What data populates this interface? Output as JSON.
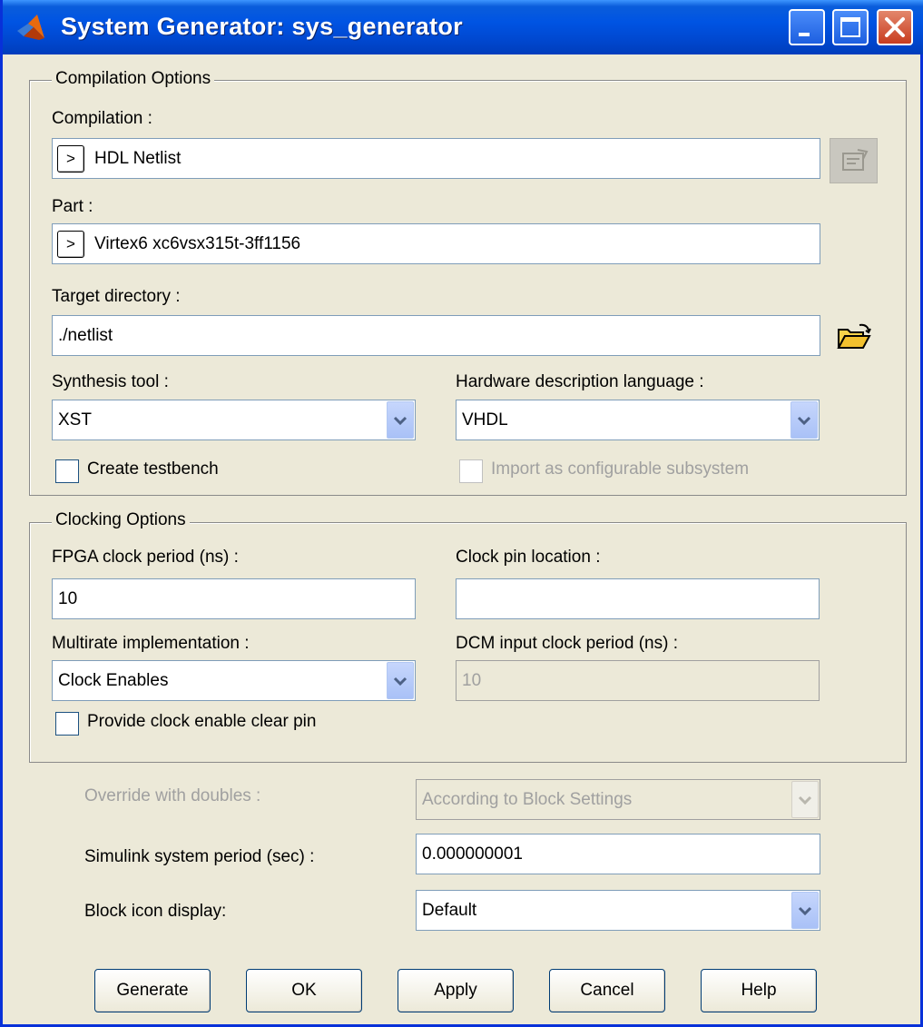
{
  "window": {
    "title": "System Generator: sys_generator",
    "accent_color": "#0054e3",
    "close_color": "#c83c1f"
  },
  "compilation_options": {
    "group_title": "Compilation Options",
    "compilation_label": "Compilation :",
    "compilation_value": "HDL Netlist",
    "expander_glyph": ">",
    "settings_icon": "compilation-settings-icon",
    "part_label": "Part :",
    "part_value": "Virtex6  xc6vsx315t-3ff1156",
    "target_dir_label": "Target directory :",
    "target_dir_value": "./netlist",
    "browse_icon": "folder-open-icon",
    "synthesis_tool_label": "Synthesis tool :",
    "synthesis_tool_value": "XST",
    "hdl_label": "Hardware description language :",
    "hdl_value": "VHDL",
    "create_testbench_label": "Create testbench",
    "create_testbench_checked": false,
    "import_subsystem_label": "Import as configurable subsystem",
    "import_subsystem_checked": false
  },
  "clocking_options": {
    "group_title": "Clocking Options",
    "fpga_clock_label": "FPGA clock period (ns) :",
    "fpga_clock_value": "10",
    "clock_pin_label": "Clock pin location :",
    "clock_pin_value": "",
    "multirate_label": "Multirate implementation :",
    "multirate_value": "Clock Enables",
    "dcm_label": "DCM input clock period (ns) :",
    "dcm_value": "10",
    "clear_pin_label": "Provide clock enable clear pin",
    "clear_pin_checked": false
  },
  "misc": {
    "override_label": "Override with doubles :",
    "override_value": "According to Block Settings",
    "sim_period_label": "Simulink system period (sec) :",
    "sim_period_value": "0.000000001",
    "icon_display_label": "Block icon display:",
    "icon_display_value": "Default"
  },
  "buttons": {
    "generate": "Generate",
    "ok": "OK",
    "apply": "Apply",
    "cancel": "Cancel",
    "help": "Help"
  }
}
